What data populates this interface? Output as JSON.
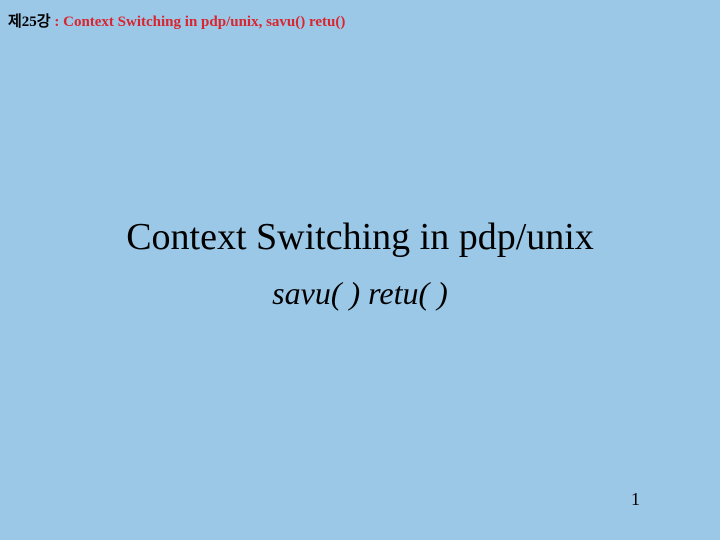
{
  "header": {
    "lecture_prefix": "제25강",
    "separator": " : ",
    "topic": "Context Switching in pdp/unix, savu() retu()"
  },
  "title": "Context Switching in pdp/unix",
  "subtitle": "savu( )  retu( )",
  "page_number": "1"
}
